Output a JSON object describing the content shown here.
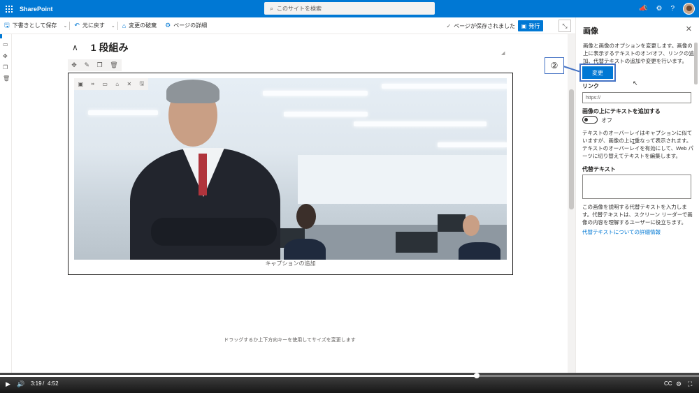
{
  "app": {
    "name": "SharePoint"
  },
  "search": {
    "placeholder": "このサイトを検索"
  },
  "commandbar": {
    "save_draft": "下書きとして保存",
    "undo": "元に戻す",
    "discard": "変更の破棄",
    "page_details": "ページの詳細",
    "saved_status": "ページが保存されました",
    "publish": "発行"
  },
  "section": {
    "title": "1 段組み"
  },
  "image": {
    "caption_placeholder": "キャプションの追加"
  },
  "drag_hint": "ドラッグするか上下方向キーを使用してサイズを変更します",
  "panel": {
    "title": "画像",
    "description": "画像と画像のオプションを変更します。画像の上に表示するテキストのオン/オフ、リンクの追加、代替テキストの追加や変更を行います。",
    "change_button": "変更",
    "link_label": "リンク",
    "link_placeholder": "https://",
    "overlay_label": "画像の上にテキストを追加する",
    "overlay_state": "オフ",
    "overlay_desc": "テキストのオーバーレイはキャプションに似ていますが、画像の上に重なって表示されます。テキストのオーバーレイを有効にして、Web パーツに切り替えてテキストを編集します。",
    "alt_label": "代替テキスト",
    "alt_help": "この画像を説明する代替テキストを入力します。代替テキストは、スクリーン リーダーで画像の内容を理解するユーザーに役立ちます。",
    "alt_link": "代替テキストについての詳細情報"
  },
  "annotation": {
    "number": "②"
  },
  "player": {
    "current": "3:19",
    "divider": "/",
    "total": "4:52",
    "progress": 0.682
  },
  "colors": {
    "brand": "#0078d4",
    "annotation": "#4472c4"
  }
}
